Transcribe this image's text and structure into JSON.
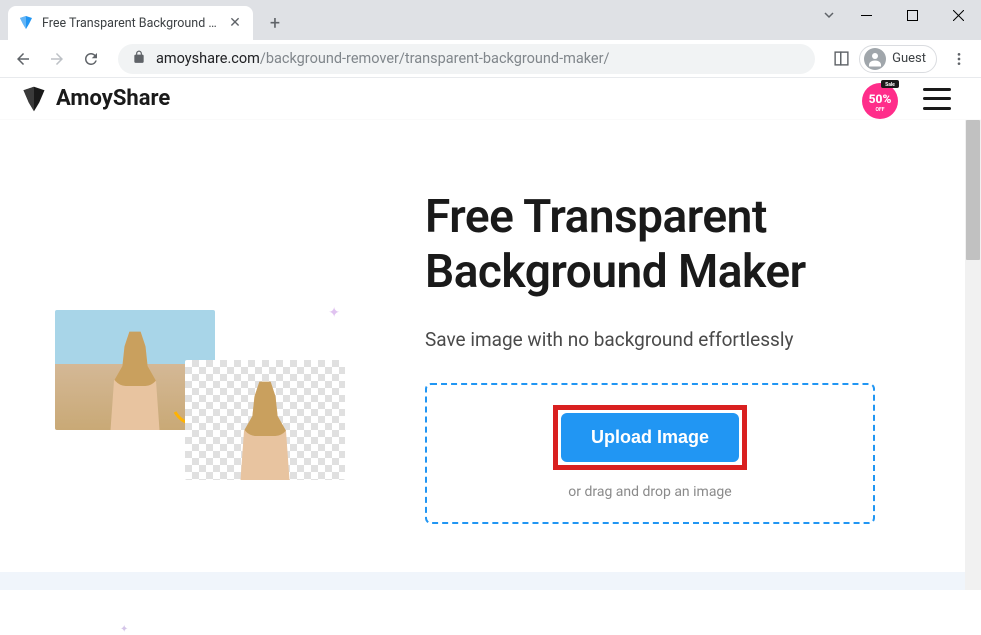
{
  "browser": {
    "tab_title": "Free Transparent Background M",
    "url_domain": "amoyshare.com",
    "url_path": "/background-remover/transparent-background-maker/",
    "guest_label": "Guest"
  },
  "site": {
    "logo_text": "AmoyShare",
    "sale_percent": "50%",
    "sale_tag": "Sale",
    "sale_off": "OFF"
  },
  "page": {
    "heading": "Free Transparent Background Maker",
    "subheading": "Save image with no background effortlessly",
    "upload_button": "Upload Image",
    "drag_text": "or drag and drop an image"
  },
  "colors": {
    "primary": "#2196f3",
    "highlight_border": "#d92020",
    "sale_badge": "#ff2d8a"
  }
}
